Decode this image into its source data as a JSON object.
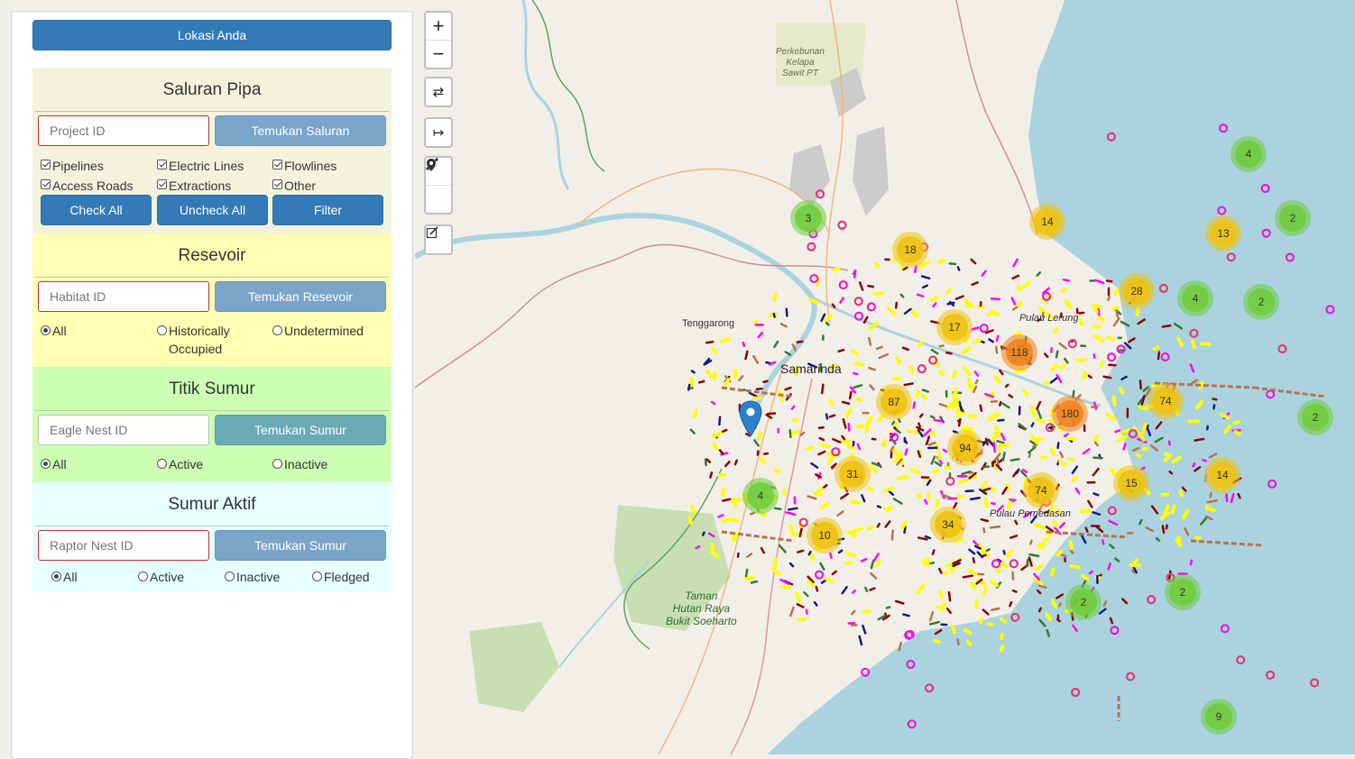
{
  "sidebar": {
    "locate_button": "Lokasi Anda",
    "pipeline_section": {
      "title": "Saluran Pipa",
      "bg_color": "#f3f3dc",
      "input_placeholder": "Project ID",
      "search_button": "Temukan Saluran",
      "checkboxes": [
        {
          "label": "Pipelines",
          "checked": true
        },
        {
          "label": "Electric Lines",
          "checked": true
        },
        {
          "label": "Flowlines",
          "checked": true
        },
        {
          "label": "Access Roads",
          "checked": true
        },
        {
          "label": "Extractions",
          "checked": true
        },
        {
          "label": "Other",
          "checked": true
        }
      ],
      "check_all": "Check All",
      "uncheck_all": "Uncheck All",
      "filter": "Filter"
    },
    "reservoir_section": {
      "title": "Resevoir",
      "bg_color": "#ffffb3",
      "input_placeholder": "Habitat ID",
      "search_button": "Temukan Resevoir",
      "radios": [
        {
          "label": "All",
          "selected": true
        },
        {
          "label": "Historically Occupied",
          "selected": false
        },
        {
          "label": "Undetermined",
          "selected": false
        }
      ]
    },
    "well_section": {
      "title": "Titik Sumur",
      "bg_color": "#ccffb3",
      "input_placeholder": "Eagle Nest ID",
      "search_button": "Temukan Sumur",
      "radios": [
        {
          "label": "All",
          "selected": true
        },
        {
          "label": "Active",
          "selected": false
        },
        {
          "label": "Inactive",
          "selected": false
        }
      ]
    },
    "active_well_section": {
      "title": "Sumur Aktif",
      "bg_color": "#e6ffff",
      "input_placeholder": "Raptor Nest ID",
      "search_button": "Temukan Sumur",
      "radios": [
        {
          "label": "All",
          "selected": true
        },
        {
          "label": "Active",
          "selected": false
        },
        {
          "label": "Inactive",
          "selected": false
        },
        {
          "label": "Fledged",
          "selected": false
        }
      ]
    }
  },
  "map": {
    "zoom_in": "+",
    "zoom_out": "−",
    "labels": {
      "samarinda": "Samarinda",
      "tenggarong": "Tenggarong",
      "pulau_lerung": "Pulau Lerung",
      "pulau_pemedas": "Pulau Pemedasan",
      "perkebunan": [
        "Perkebunan",
        "Kelapa",
        "Sawit PT"
      ],
      "taman": [
        "Taman",
        "Hutan Raya",
        "Bukit Soeharto"
      ]
    },
    "clusters": [
      "4",
      "2",
      "3",
      "18",
      "14",
      "13",
      "28",
      "4",
      "2",
      "17",
      "118",
      "87",
      "180",
      "74",
      "2",
      "94",
      "31",
      "74",
      "15",
      "14",
      "4",
      "34",
      "10",
      "2",
      "2",
      "9"
    ],
    "colors": {
      "sea": "#aad3df",
      "land": "#f2efe9",
      "cluster_small": "#6ecc39",
      "cluster_medium": "#f0c20c",
      "cluster_large": "#f18017",
      "marker": "#2a81cb"
    }
  }
}
